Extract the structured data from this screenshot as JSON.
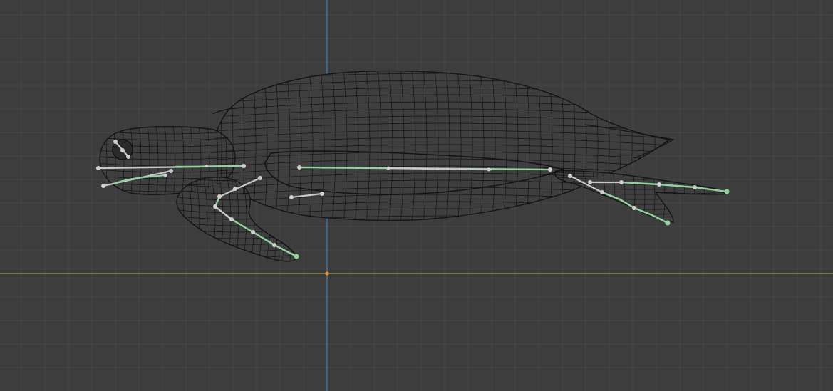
{
  "viewport": {
    "view": "side-orthographic",
    "background_color": "#3d3d3d",
    "grid": true,
    "grid_line_color": "#474747",
    "x_axis_color": "#8aa545",
    "z_axis_color": "#3b7fc1",
    "origin_marker_color": "#f08a24"
  },
  "scene_objects": [
    {
      "name": "turtle-mesh",
      "type": "mesh",
      "display": "wireframe",
      "wire_color": "#141414",
      "body_fill_color": "#3f3f3f"
    },
    {
      "name": "turtle-armature",
      "type": "armature",
      "display": "stick",
      "selected_bone_color": "#8fd49b",
      "unselected_bone_color": "#c8c8c8",
      "joint_color": "#d0d0d0",
      "bone_groups": [
        "head",
        "jaw",
        "eye",
        "spine",
        "front-flipper",
        "front-flipper-root",
        "pelvis",
        "rear-flipper-upper",
        "rear-flipper-lower"
      ]
    }
  ]
}
